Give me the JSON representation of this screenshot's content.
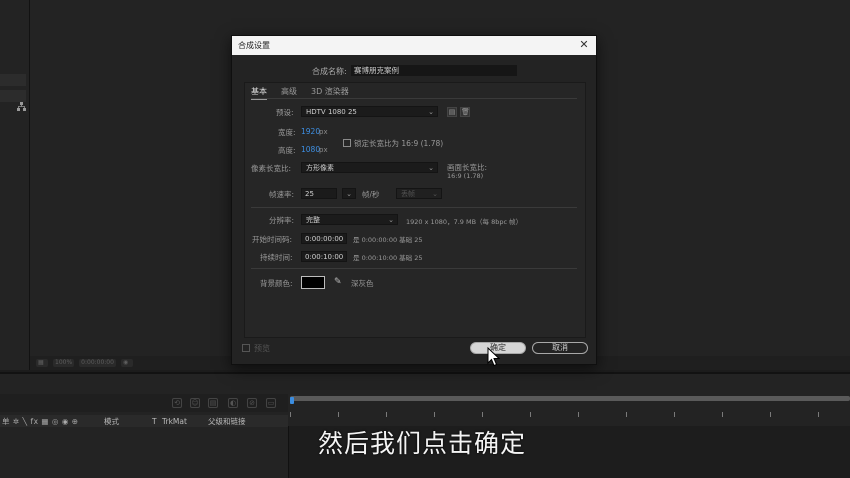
{
  "app": {
    "viewer_toolbar": [
      "100%",
      "0:00:00:00"
    ],
    "left_panel_icon": "hierarchy-icon"
  },
  "dialog": {
    "title": "合成设置",
    "close_glyph": "✕",
    "name_label": "合成名称:",
    "name_value": "赛博朋克案例",
    "tabs": [
      "基本",
      "高级",
      "3D 渲染器"
    ],
    "preset_label": "预设:",
    "preset_value": "HDTV 1080 25",
    "width_label": "宽度:",
    "width_value": "1920",
    "width_unit": "px",
    "height_label": "高度:",
    "height_value": "1080",
    "height_unit": "px",
    "lock_ratio_label": "锁定长宽比为 16:9 (1.78)",
    "pixel_aspect_label": "像素长宽比:",
    "pixel_aspect_value": "方形像素",
    "frame_aspect_label": "画面长宽比:",
    "frame_aspect_value": "16:9 (1.78)",
    "frame_rate_label": "帧速率:",
    "frame_rate_value": "25",
    "fps_label": "帧/秒",
    "drop_frame_value": "丢帧",
    "resolution_label": "分辨率:",
    "resolution_value": "完整",
    "resolution_info": "1920 x 1080，7.9 MB（每 8bpc 帧）",
    "start_tc_label": "开始时间码:",
    "start_tc_value": "0:00:00:00",
    "start_tc_info": "是 0:00:00:00  基础 25",
    "duration_label": "持续时间:",
    "duration_value": "0:00:10:00",
    "duration_info": "是 0:00:10:00  基础 25",
    "bg_color_label": "背景颜色:",
    "bg_color_value": "#000000",
    "bg_color_name": "深灰色",
    "preview_label": "预览",
    "ok_label": "确定",
    "cancel_label": "取消"
  },
  "timeline": {
    "columns": {
      "switches": "单 ✲ ╲ fx ▦ ◎ ◉ ⊕",
      "mode": "模式",
      "t": "T",
      "trkmat": "TrkMat",
      "parent": "父级和链接"
    }
  },
  "subtitle": "然后我们点击确定",
  "colors": {
    "accent_blue": "#3d8fe3",
    "dialog_bg": "#232323",
    "titlebar_bg": "#f4f4f4"
  }
}
